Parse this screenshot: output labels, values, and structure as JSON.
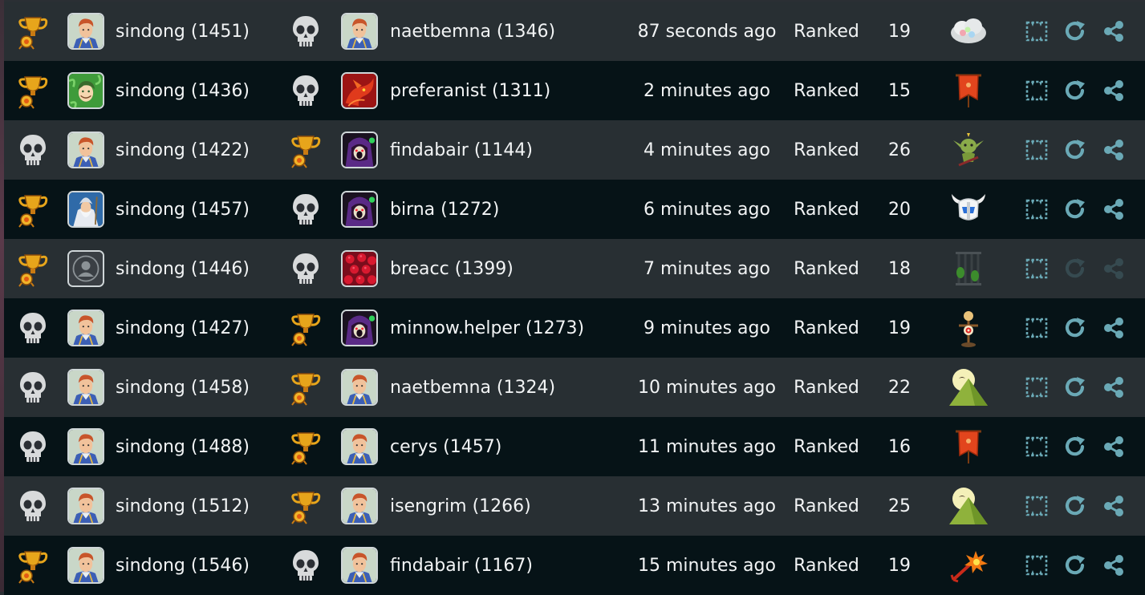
{
  "mode_label": "Ranked",
  "colors": {
    "accent_icon": "#6aa9b6",
    "row_light": "#282f33",
    "row_dark": "#061317"
  },
  "games": [
    {
      "p1_result": "win",
      "p1_avatar": "knight",
      "p1_name": "sindong (1451)",
      "p2_result": "loss",
      "p2_avatar": "knight",
      "p2_name": "naetbemna (1346)",
      "time": "87 seconds ago",
      "mode": "Ranked",
      "turns": "19",
      "board": "cloud",
      "actions_enabled": true
    },
    {
      "p1_result": "win",
      "p1_avatar": "elf",
      "p1_name": "sindong (1436)",
      "p2_result": "loss",
      "p2_avatar": "dragon",
      "p2_name": "preferanist (1311)",
      "time": "2 minutes ago",
      "mode": "Ranked",
      "turns": "15",
      "board": "banner",
      "actions_enabled": true
    },
    {
      "p1_result": "loss",
      "p1_avatar": "knight",
      "p1_name": "sindong (1422)",
      "p2_result": "win",
      "p2_avatar": "sorcerer",
      "p2_name": "findabair (1144)",
      "time": "4 minutes ago",
      "mode": "Ranked",
      "turns": "26",
      "board": "goblin",
      "actions_enabled": true
    },
    {
      "p1_result": "win",
      "p1_avatar": "wizard",
      "p1_name": "sindong (1457)",
      "p2_result": "loss",
      "p2_avatar": "sorcerer",
      "p2_name": "birna (1272)",
      "time": "6 minutes ago",
      "mode": "Ranked",
      "turns": "20",
      "board": "helmet",
      "actions_enabled": true
    },
    {
      "p1_result": "win",
      "p1_avatar": "default",
      "p1_name": "sindong (1446)",
      "p2_result": "loss",
      "p2_avatar": "raspberry",
      "p2_name": "breacc (1399)",
      "time": "7 minutes ago",
      "mode": "Ranked",
      "turns": "18",
      "board": "cage",
      "actions_enabled": false
    },
    {
      "p1_result": "loss",
      "p1_avatar": "knight",
      "p1_name": "sindong (1427)",
      "p2_result": "win",
      "p2_avatar": "sorcerer",
      "p2_name": "minnow.helper (1273)",
      "time": "9 minutes ago",
      "mode": "Ranked",
      "turns": "19",
      "board": "dummy",
      "actions_enabled": true
    },
    {
      "p1_result": "loss",
      "p1_avatar": "knight",
      "p1_name": "sindong (1458)",
      "p2_result": "win",
      "p2_avatar": "knight",
      "p2_name": "naetbemna (1324)",
      "time": "10 minutes ago",
      "mode": "Ranked",
      "turns": "22",
      "board": "mountain",
      "actions_enabled": true
    },
    {
      "p1_result": "loss",
      "p1_avatar": "knight",
      "p1_name": "sindong (1488)",
      "p2_result": "win",
      "p2_avatar": "knight",
      "p2_name": "cerys (1457)",
      "time": "11 minutes ago",
      "mode": "Ranked",
      "turns": "16",
      "board": "banner",
      "actions_enabled": true
    },
    {
      "p1_result": "loss",
      "p1_avatar": "knight",
      "p1_name": "sindong (1512)",
      "p2_result": "win",
      "p2_avatar": "knight",
      "p2_name": "isengrim (1266)",
      "time": "13 minutes ago",
      "mode": "Ranked",
      "turns": "25",
      "board": "mountain",
      "actions_enabled": true
    },
    {
      "p1_result": "win",
      "p1_avatar": "knight",
      "p1_name": "sindong (1546)",
      "p2_result": "loss",
      "p2_avatar": "knight",
      "p2_name": "findabair (1167)",
      "time": "15 minutes ago",
      "mode": "Ranked",
      "turns": "19",
      "board": "explosion",
      "actions_enabled": true
    }
  ]
}
